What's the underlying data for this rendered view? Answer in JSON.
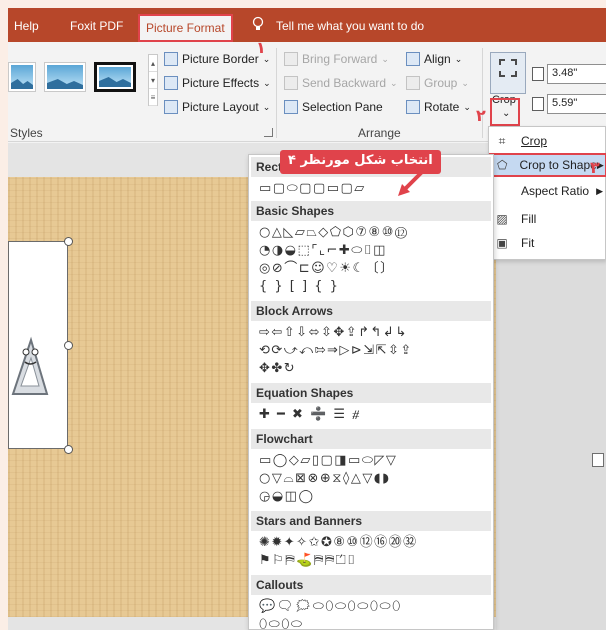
{
  "tabs": {
    "help": "Help",
    "foxit": "Foxit PDF",
    "picture_format": "Picture Format",
    "tell_me": "Tell me what you want to do"
  },
  "ribbon": {
    "picture_border": "Picture Border",
    "picture_effects": "Picture Effects",
    "picture_layout": "Picture Layout",
    "styles_label": "Styles",
    "bring_forward": "Bring Forward",
    "send_backward": "Send Backward",
    "selection_pane": "Selection Pane",
    "align": "Align",
    "group": "Group",
    "rotate": "Rotate",
    "arrange_label": "Arrange",
    "crop_label": "Crop",
    "height": "3.48\"",
    "width": "5.59\""
  },
  "crop_menu": {
    "crop": "Crop",
    "crop_to_shape": "Crop to Shape",
    "aspect_ratio": "Aspect Ratio",
    "fill": "Fill",
    "fit": "Fit"
  },
  "shapes_gallery": {
    "rectangles_header": "Recta",
    "rectangles_row": "▭▢⬭▢▢▭▢▱",
    "basic_header": "Basic Shapes",
    "basic_rows": [
      "○△◺▱⏢◇⬠⬡⑦⑧⑩⑫",
      "◔◑◒⬚⌜⌞⌐✚⬭⌷◫",
      "◎⊘⌒⊏☺♡☀☾〔〕",
      "{ } [ ] { }"
    ],
    "block_arrows_header": "Block Arrows",
    "block_arrows_rows": [
      "⇨⇦⇧⇩⬄⇳✥⇪↱↰↲↳",
      "⟲⟳⤻⤺⇰⇒▷⊳⇲⇱⇳⇪",
      "✥✤↻"
    ],
    "equation_header": "Equation Shapes",
    "equation_row": "✚ ━ ✖ ➗ ☰ ⧣",
    "flowchart_header": "Flowchart",
    "flowchart_rows": [
      "▭◯◇▱▯▢◨▭⬭◸▽",
      "○▽⌓⊠⊗⊕⧖◊△▽◖◗",
      "◶◒◫◯"
    ],
    "stars_header": "Stars and Banners",
    "stars_rows": [
      "✺✹✦✧✩✪⑧⑩⑫⑯⑳㉜",
      "⚑⚐⛿⛳⛿⛿⏍⌷"
    ],
    "callouts_header": "Callouts",
    "callouts_rows": [
      "💬🗨🗯⬭⬯⬭⬯⬭⬯⬭⬯",
      "⬯⬭⬯⬭"
    ]
  },
  "annotations": {
    "callout_text": "انتخاب شکل مورنظر",
    "n1": "۱",
    "n2": "۲",
    "n3": "۳",
    "n4": "۴"
  },
  "colors": {
    "accent": "#b7472a",
    "annotation": "#e0434b",
    "highlight": "#c5d9f1"
  }
}
